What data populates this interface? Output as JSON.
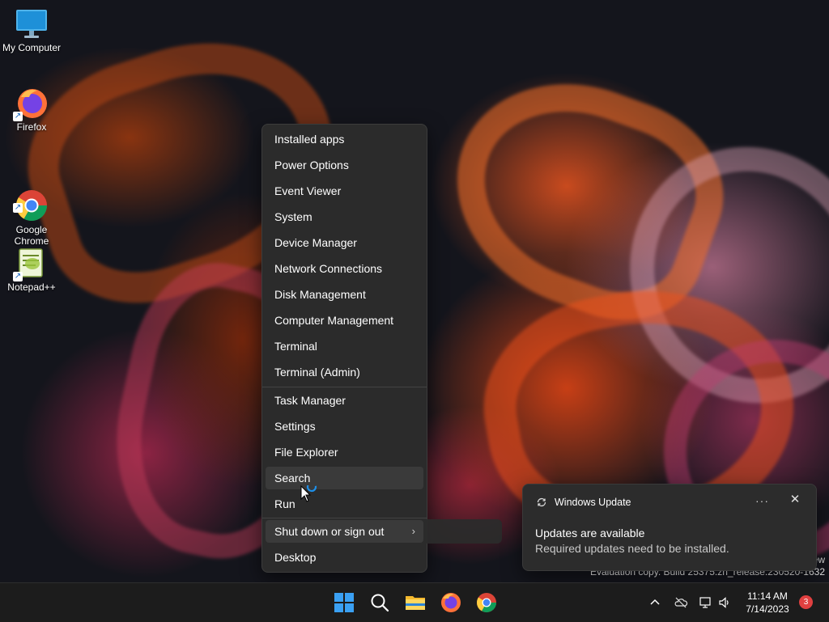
{
  "desktop_icons": [
    {
      "label": "My Computer",
      "icon": "monitor-icon"
    },
    {
      "label": "Firefox",
      "icon": "firefox-icon"
    },
    {
      "label": "Google\nChrome",
      "icon": "chrome-icon"
    },
    {
      "label": "Notepad++",
      "icon": "notepadpp-icon"
    }
  ],
  "context_menu": {
    "items": [
      "Installed apps",
      "Power Options",
      "Event Viewer",
      "System",
      "Device Manager",
      "Network Connections",
      "Disk Management",
      "Computer Management",
      "Terminal",
      "Terminal (Admin)",
      "Task Manager",
      "Settings",
      "File Explorer",
      "Search",
      "Run",
      "Shut down or sign out",
      "Desktop"
    ],
    "hovered": "Search",
    "submenu_item": "Shut down or sign out"
  },
  "notification": {
    "app": "Windows Update",
    "title": "Updates are available",
    "body": "Required updates need to be installed.",
    "more_label": "···",
    "close_label": "✕"
  },
  "watermark": {
    "edge_text": "ew",
    "line": "Evaluation copy. Build 25375.zn_release.230520-1632"
  },
  "taskbar": {
    "apps": [
      "start-icon",
      "search-icon",
      "file-explorer-icon",
      "firefox-icon",
      "chrome-icon"
    ],
    "tray": {
      "time": "11:14 AM",
      "date": "7/14/2023",
      "notification_count": "3"
    }
  },
  "colors": {
    "accent": "#0078d4",
    "menu_bg": "#2b2b2b",
    "taskbar_bg": "#1c1c1c",
    "badge": "#e04040"
  }
}
